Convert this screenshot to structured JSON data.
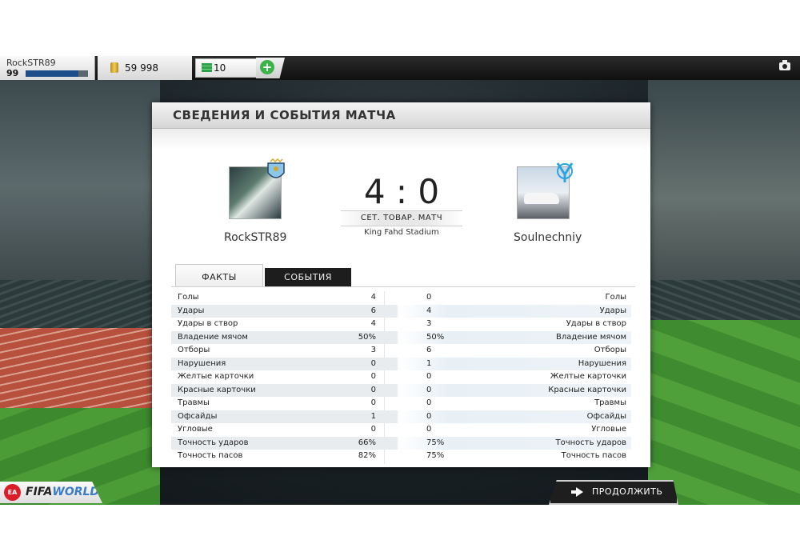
{
  "header": {
    "player_name": "RockSTR89",
    "player_level": "99",
    "xp_progress": 0.85,
    "coins": "59 998",
    "points": "10",
    "add_label": "+"
  },
  "panel": {
    "title": "СВЕДЕНИЯ И СОБЫТИЯ МАТЧА",
    "home_team": "RockSTR89",
    "away_team": "Soulnechniy",
    "score": "4 : 0",
    "match_type": "СЕТ. ТОВАР. МАТЧ",
    "stadium": "King Fahd Stadium"
  },
  "tabs": {
    "facts": "ФАКТЫ",
    "events": "СОБЫТИЯ"
  },
  "stats": [
    {
      "label": "Голы",
      "home": "4",
      "away": "0"
    },
    {
      "label": "Удары",
      "home": "6",
      "away": "4"
    },
    {
      "label": "Удары в створ",
      "home": "4",
      "away": "3"
    },
    {
      "label": "Владение мячом",
      "home": "50%",
      "away": "50%"
    },
    {
      "label": "Отборы",
      "home": "3",
      "away": "6"
    },
    {
      "label": "Нарушения",
      "home": "0",
      "away": "1"
    },
    {
      "label": "Желтые карточки",
      "home": "0",
      "away": "0"
    },
    {
      "label": "Красные карточки",
      "home": "0",
      "away": "0"
    },
    {
      "label": "Травмы",
      "home": "0",
      "away": "0"
    },
    {
      "label": "Офсайды",
      "home": "1",
      "away": "0"
    },
    {
      "label": "Угловые",
      "home": "0",
      "away": "0"
    },
    {
      "label": "Точность ударов",
      "home": "66%",
      "away": "75%"
    },
    {
      "label": "Точность пасов",
      "home": "82%",
      "away": "75%"
    }
  ],
  "footer": {
    "continue_label": "ПРОДОЛЖИТЬ",
    "logo_ea": "EA",
    "logo_fifa": "FIFA",
    "logo_world": "WORLD"
  },
  "colors": {
    "accent_green": "#3ab34a",
    "xp_blue": "#1e4e8a",
    "dark_tab": "#1d1d1d"
  }
}
